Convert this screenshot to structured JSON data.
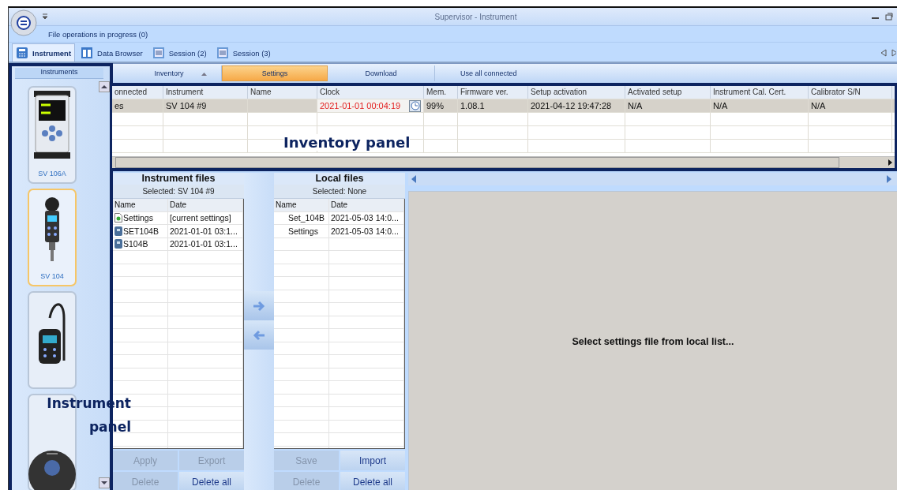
{
  "window": {
    "title": "Supervisor - Instrument"
  },
  "status": "File operations in progress (0)",
  "tabs": [
    {
      "label": "Instrument",
      "selected": true,
      "kind": "instrument"
    },
    {
      "label": "Data Browser",
      "selected": false,
      "kind": "browser"
    },
    {
      "label": "Session (2)",
      "selected": false,
      "kind": "session"
    },
    {
      "label": "Session (3)",
      "selected": false,
      "kind": "session"
    }
  ],
  "instrument_panel": {
    "header": "Instruments",
    "annotation": "Instrument panel",
    "items": [
      {
        "label": "SV 106A",
        "selected": false,
        "kind": "meter"
      },
      {
        "label": "SV 104",
        "selected": true,
        "kind": "dosimeter"
      },
      {
        "selected": false,
        "kind": "corded"
      },
      {
        "selected": false,
        "kind": "disc"
      }
    ]
  },
  "toolbar": [
    {
      "label": "Inventory",
      "selected": false,
      "sortable": true
    },
    {
      "label": "Settings",
      "selected": true,
      "sortable": false
    },
    {
      "label": "Download",
      "selected": false,
      "sortable": false
    },
    {
      "label": "Use all connected",
      "selected": false,
      "sortable": false
    }
  ],
  "inventory": {
    "annotation": "Inventory panel",
    "columns": [
      "onnected",
      "Instrument",
      "Name",
      "Clock",
      "Mem.",
      "Firmware ver.",
      "Setup activation",
      "Activated setup",
      "Instrument Cal. Cert.",
      "Calibrator S/N"
    ],
    "rows": [
      {
        "selected": true,
        "cells": [
          {
            "text": "es",
            "alert": false
          },
          {
            "text": "SV 104 #9",
            "alert": false
          },
          {
            "text": "",
            "alert": false
          },
          {
            "text": "2021-01-01 00:04:19",
            "alert": true,
            "kind": "clock"
          },
          {
            "text": "99%",
            "alert": false
          },
          {
            "text": "1.08.1",
            "alert": false
          },
          {
            "text": "2021-04-12 19:47:28",
            "alert": false
          },
          {
            "text": "N/A",
            "alert": false
          },
          {
            "text": "N/A",
            "alert": false
          },
          {
            "text": "N/A",
            "alert": false
          }
        ]
      }
    ]
  },
  "instrument_files": {
    "title": "Instrument files",
    "selected_label": "Selected: SV 104 #9",
    "columns": [
      "Name",
      "Date"
    ],
    "rows": [
      {
        "kind": "settings",
        "name": "Settings",
        "date": "[current settings]"
      },
      {
        "kind": "instrument_file",
        "name": "SET104B",
        "date": "2021-01-01 03:1..."
      },
      {
        "kind": "instrument_file",
        "name": "S104B",
        "date": "2021-01-01 03:1..."
      }
    ],
    "buttons": [
      {
        "label": "Apply",
        "disabled": true
      },
      {
        "label": "Export",
        "disabled": true
      },
      {
        "label": "Delete",
        "disabled": true
      },
      {
        "label": "Delete all",
        "disabled": false
      }
    ]
  },
  "local_files": {
    "title": "Local files",
    "selected_label": "Selected: None",
    "columns": [
      "Name",
      "Date"
    ],
    "rows": [
      {
        "kind": "local_file",
        "name": "Set_104B",
        "date": "2021-05-03 14:0..."
      },
      {
        "kind": "local_file",
        "name": "Settings",
        "date": "2021-05-03 14:0..."
      }
    ],
    "buttons": [
      {
        "label": "Save",
        "disabled": true
      },
      {
        "label": "Import",
        "disabled": false
      },
      {
        "label": "Delete",
        "disabled": true
      },
      {
        "label": "Delete all",
        "disabled": false
      }
    ]
  },
  "preview": {
    "message": "Select settings file from local list..."
  }
}
